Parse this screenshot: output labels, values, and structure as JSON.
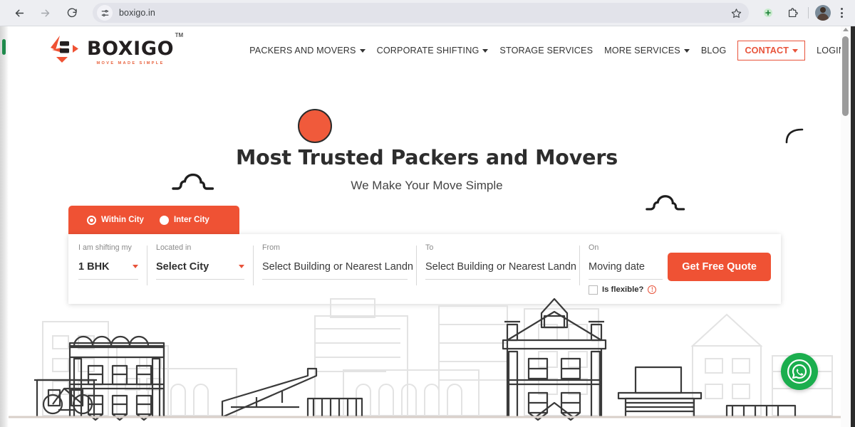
{
  "browser": {
    "url": "boxigo.in",
    "back_icon": "back-arrow-icon",
    "forward_icon": "forward-arrow-icon",
    "reload_icon": "reload-icon",
    "site_info_icon": "site-settings-icon",
    "bookmark_icon": "star-icon",
    "install_icon": "install-plus-icon",
    "extensions_icon": "puzzle-piece-icon",
    "avatar_icon": "profile-avatar-icon",
    "menu_icon": "kebab-menu-icon"
  },
  "site": {
    "logo": {
      "wordmark": "BOXIGO",
      "tagline": "MOVE MADE SIMPLE",
      "trademark": "TM"
    },
    "nav": [
      {
        "label": "PACKERS AND MOVERS",
        "caret": true,
        "highlight": false
      },
      {
        "label": "CORPORATE SHIFTING",
        "caret": true,
        "highlight": false
      },
      {
        "label": "STORAGE SERVICES",
        "caret": false,
        "highlight": false
      },
      {
        "label": "MORE SERVICES",
        "caret": true,
        "highlight": false
      },
      {
        "label": "BLOG",
        "caret": false,
        "highlight": false
      },
      {
        "label": "CONTACT",
        "caret": true,
        "highlight": true
      },
      {
        "label": "LOGIN",
        "caret": true,
        "highlight": false
      }
    ]
  },
  "hero": {
    "title": "Most Trusted Packers and Movers",
    "subtitle": "We Make Your Move Simple"
  },
  "quote_form": {
    "tabs": [
      {
        "label": "Within City",
        "selected": true
      },
      {
        "label": "Inter City",
        "selected": false
      }
    ],
    "fields": {
      "shifting": {
        "label": "I am shifting my",
        "value": "1 BHK"
      },
      "located": {
        "label": "Located in",
        "value": "Select City"
      },
      "from": {
        "label": "From",
        "value": "Select Building or Nearest Landn"
      },
      "to": {
        "label": "To",
        "value": "Select Building or Nearest Landn"
      },
      "on": {
        "label": "On",
        "value": "Moving date"
      }
    },
    "flexible": {
      "label": "Is flexible?",
      "checked": false,
      "info_icon": "info-circle-icon"
    },
    "submit_label": "Get Free Quote"
  },
  "floating": {
    "whatsapp_icon": "whatsapp-icon"
  },
  "decorations": {
    "sun_icon": "sun-icon",
    "cloud_left_icon": "cloud-icon",
    "cloud_right_icon": "cloud-icon",
    "arc_icon": "arc-icon",
    "skyline_icon": "city-skyline-illustration"
  },
  "colors": {
    "brand_orange": "#ef5234",
    "accent_orange": "#e8533a",
    "whatsapp_green": "#1bae4e",
    "text_dark": "#2d2d2d",
    "chrome_bg": "#edeef2"
  }
}
